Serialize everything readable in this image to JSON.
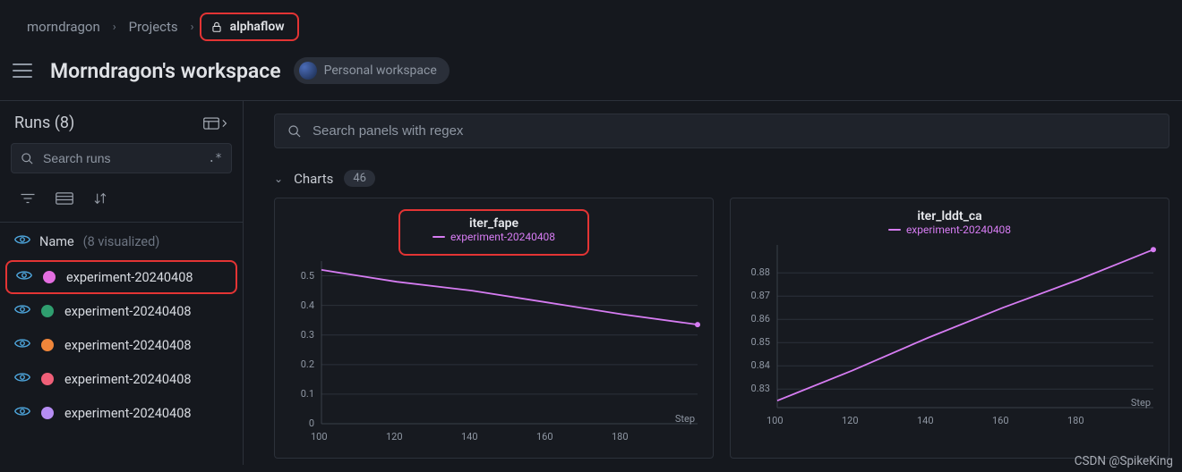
{
  "breadcrumb": {
    "user": "morndragon",
    "projects": "Projects",
    "project": "alphaflow"
  },
  "workspace": {
    "title": "Morndragon's workspace",
    "badge": "Personal workspace"
  },
  "sidebar": {
    "runs_title": "Runs (8)",
    "search_placeholder": "Search runs",
    "regex_hint": ".*",
    "name_header": "Name",
    "visualized_hint": "(8 visualized)",
    "runs": [
      {
        "label": "experiment-20240408",
        "color": "#e36ee0",
        "highlighted": true
      },
      {
        "label": "experiment-20240408",
        "color": "#2f9e6f",
        "highlighted": false
      },
      {
        "label": "experiment-20240408",
        "color": "#f0863a",
        "highlighted": false
      },
      {
        "label": "experiment-20240408",
        "color": "#ef5f78",
        "highlighted": false
      },
      {
        "label": "experiment-20240408",
        "color": "#b68df3",
        "highlighted": false
      }
    ]
  },
  "content": {
    "panel_search_placeholder": "Search panels with regex",
    "section_title": "Charts",
    "chart_count": "46"
  },
  "chart_data": [
    {
      "type": "line",
      "title": "iter_fape",
      "legend": "experiment-20240408",
      "xlabel": "Step",
      "ylabel": "",
      "highlighted_title": true,
      "x": [
        100,
        120,
        140,
        160,
        180,
        200
      ],
      "xticks": [
        100,
        120,
        140,
        160,
        180
      ],
      "yticks": [
        0,
        0.1,
        0.2,
        0.3,
        0.4,
        0.5
      ],
      "ylim": [
        0,
        0.55
      ],
      "series": [
        {
          "name": "experiment-20240408",
          "color": "#d67cf2",
          "values": [
            0.52,
            0.48,
            0.45,
            0.41,
            0.37,
            0.335
          ]
        }
      ]
    },
    {
      "type": "line",
      "title": "iter_lddt_ca",
      "legend": "experiment-20240408",
      "xlabel": "Step",
      "ylabel": "",
      "highlighted_title": false,
      "x": [
        100,
        120,
        140,
        160,
        180,
        200
      ],
      "xticks": [
        100,
        120,
        140,
        160,
        180
      ],
      "yticks": [
        0.83,
        0.84,
        0.85,
        0.86,
        0.87,
        0.88
      ],
      "ylim": [
        0.822,
        0.892
      ],
      "series": [
        {
          "name": "experiment-20240408",
          "color": "#d67cf2",
          "values": [
            0.825,
            0.838,
            0.852,
            0.865,
            0.877,
            0.89
          ]
        }
      ]
    }
  ],
  "watermark": "CSDN @SpikeKing"
}
